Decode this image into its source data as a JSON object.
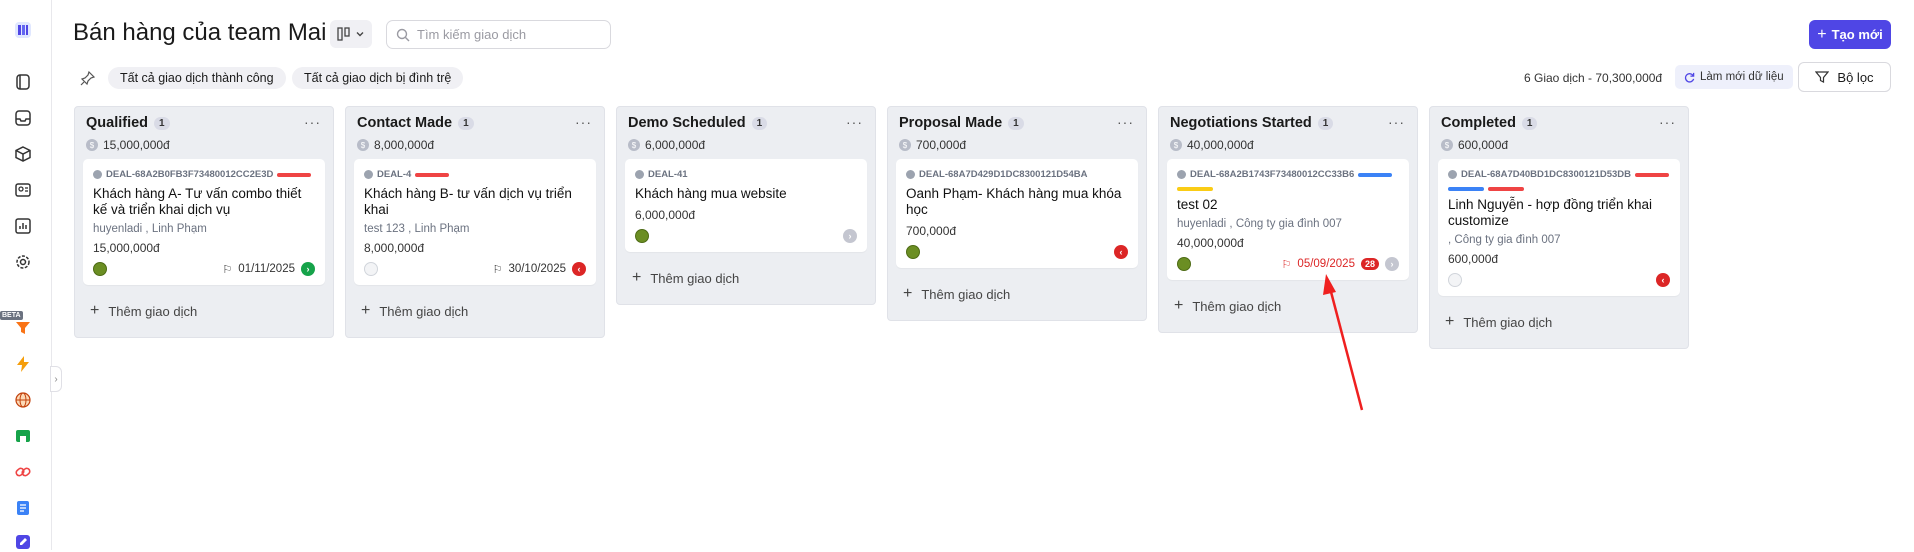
{
  "header": {
    "title": "Bán hàng của team Mai",
    "search_placeholder": "Tìm kiếm giao dịch",
    "new_button": "Tạo mới"
  },
  "filters": {
    "chip_won": "Tất cả giao dịch thành công",
    "chip_stalled": "Tất cả giao dịch bị đình trệ",
    "summary": "6 Giao dịch - 70,300,000đ",
    "refresh": "Làm mới dữ liệu",
    "filter": "Bộ lọc"
  },
  "sidebar": {
    "beta_label": "BETA",
    "icons": [
      "pipeline-icon",
      "book-icon",
      "inbox-icon",
      "box-icon",
      "contact-card-icon",
      "chart-icon",
      "gear-icon",
      "funnel-icon",
      "lightning-icon",
      "globe-icon",
      "store-icon",
      "link-icon",
      "document-icon",
      "edit-icon"
    ]
  },
  "add_deal_label": "Thêm giao dịch",
  "columns": [
    {
      "name": "Qualified",
      "count": "1",
      "amount": "15,000,000đ",
      "card": {
        "id": "DEAL-68A2B0FB3F73480012CC2E3D",
        "title": "Khách hàng A- Tư vấn combo thiết kế và triển khai dịch vụ",
        "sub": "huyenladi , Linh Phạm",
        "amount": "15,000,000đ",
        "date": "01/11/2025"
      }
    },
    {
      "name": "Contact Made",
      "count": "1",
      "amount": "8,000,000đ",
      "card": {
        "id": "DEAL-4",
        "title": "Khách hàng B- tư vấn dịch vụ triển khai",
        "sub": "test 123 , Linh Phạm",
        "amount": "8,000,000đ",
        "date": "30/10/2025"
      }
    },
    {
      "name": "Demo Scheduled",
      "count": "1",
      "amount": "6,000,000đ",
      "card": {
        "id": "DEAL-41",
        "title": "Khách hàng mua website",
        "sub": "",
        "amount": "6,000,000đ",
        "date": ""
      }
    },
    {
      "name": "Proposal Made",
      "count": "1",
      "amount": "700,000đ",
      "card": {
        "id": "DEAL-68A7D429D1DC8300121D54BA",
        "title": "Oanh Phạm- Khách hàng mua khóa học",
        "sub": "",
        "amount": "700,000đ",
        "date": ""
      }
    },
    {
      "name": "Negotiations Started",
      "count": "1",
      "amount": "40,000,000đ",
      "card": {
        "id": "DEAL-68A2B1743F73480012CC33B6",
        "title": "test 02",
        "sub": "huyenladi , Công ty gia đình 007",
        "amount": "40,000,000đ",
        "date": "05/09/2025",
        "overdue_days": "28"
      }
    },
    {
      "name": "Completed",
      "count": "1",
      "amount": "600,000đ",
      "card": {
        "id": "DEAL-68A7D40BD1DC8300121D53DB",
        "title": "Linh Nguyễn - hợp đồng triển khai customize",
        "sub": ", Công ty gia đình 007",
        "amount": "600,000đ",
        "date": ""
      }
    }
  ],
  "colors": {
    "accent": "#4f46e5",
    "red": "#dc2626",
    "green": "#16a34a",
    "blue": "#3b82f6",
    "yellow": "#facc15"
  }
}
